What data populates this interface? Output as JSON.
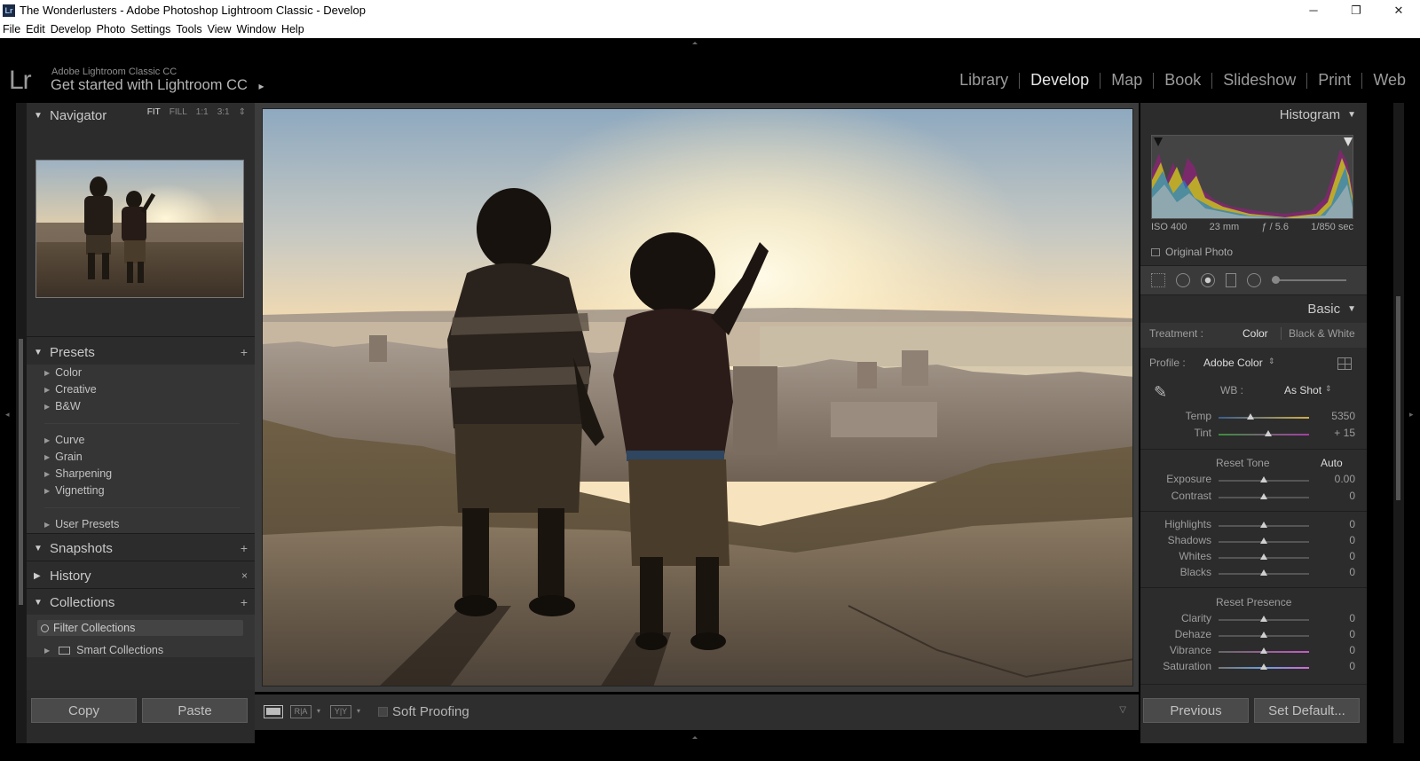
{
  "window": {
    "title": "The Wonderlusters - Adobe Photoshop Lightroom Classic - Develop",
    "app_icon": "Lr",
    "controls": [
      "─",
      "❐",
      "✕"
    ]
  },
  "menu": [
    "File",
    "Edit",
    "Develop",
    "Photo",
    "Settings",
    "Tools",
    "View",
    "Window",
    "Help"
  ],
  "identity": {
    "logo": "Lr",
    "subtitle": "Adobe Lightroom Classic CC",
    "main": "Get started with Lightroom CC",
    "arrow": "▸"
  },
  "modules": [
    {
      "label": "Library",
      "active": false
    },
    {
      "label": "Develop",
      "active": true
    },
    {
      "label": "Map",
      "active": false
    },
    {
      "label": "Book",
      "active": false
    },
    {
      "label": "Slideshow",
      "active": false
    },
    {
      "label": "Print",
      "active": false
    },
    {
      "label": "Web",
      "active": false
    }
  ],
  "left": {
    "navigator": {
      "title": "Navigator",
      "options": [
        "FIT",
        "FILL",
        "1:1",
        "3:1"
      ],
      "active_option": "FIT",
      "option_arrow": "⇕"
    },
    "presets": {
      "title": "Presets",
      "groups": [
        [
          "Color",
          "Creative",
          "B&W"
        ],
        [
          "Curve",
          "Grain",
          "Sharpening",
          "Vignetting"
        ],
        [
          "User Presets"
        ]
      ]
    },
    "snapshots": {
      "title": "Snapshots"
    },
    "history": {
      "title": "History"
    },
    "collections": {
      "title": "Collections",
      "filter": "Filter Collections",
      "smart": "Smart Collections"
    },
    "buttons": {
      "copy": "Copy",
      "paste": "Paste"
    }
  },
  "toolbar": {
    "soft_proofing": "Soft Proofing",
    "ra_label": "R|A",
    "yy_label": "Y|Y"
  },
  "right": {
    "histogram": {
      "title": "Histogram",
      "exif": [
        "ISO 400",
        "23 mm",
        "ƒ / 5.6",
        "1/850 sec"
      ],
      "original_photo": "Original Photo"
    },
    "basic": {
      "title": "Basic",
      "treatment_label": "Treatment :",
      "treatment_color": "Color",
      "treatment_bw": "Black & White",
      "profile_label": "Profile :",
      "profile_value": "Adobe Color",
      "wb_label": "WB :",
      "wb_value": "As Shot",
      "temp": {
        "label": "Temp",
        "value": "5350",
        "pos": 0.35
      },
      "tint": {
        "label": "Tint",
        "value": "+ 15",
        "pos": 0.55
      },
      "reset_tone": "Reset Tone",
      "auto": "Auto",
      "exposure": {
        "label": "Exposure",
        "value": "0.00",
        "pos": 0.5
      },
      "contrast": {
        "label": "Contrast",
        "value": "0",
        "pos": 0.5
      },
      "highlights": {
        "label": "Highlights",
        "value": "0",
        "pos": 0.5
      },
      "shadows": {
        "label": "Shadows",
        "value": "0",
        "pos": 0.5
      },
      "whites": {
        "label": "Whites",
        "value": "0",
        "pos": 0.5
      },
      "blacks": {
        "label": "Blacks",
        "value": "0",
        "pos": 0.5
      },
      "reset_presence": "Reset Presence",
      "clarity": {
        "label": "Clarity",
        "value": "0",
        "pos": 0.5
      },
      "dehaze": {
        "label": "Dehaze",
        "value": "0",
        "pos": 0.5
      },
      "vibrance": {
        "label": "Vibrance",
        "value": "0",
        "pos": 0.5
      },
      "saturation": {
        "label": "Saturation",
        "value": "0",
        "pos": 0.5
      }
    },
    "buttons": {
      "previous": "Previous",
      "set_default": "Set Default..."
    }
  }
}
